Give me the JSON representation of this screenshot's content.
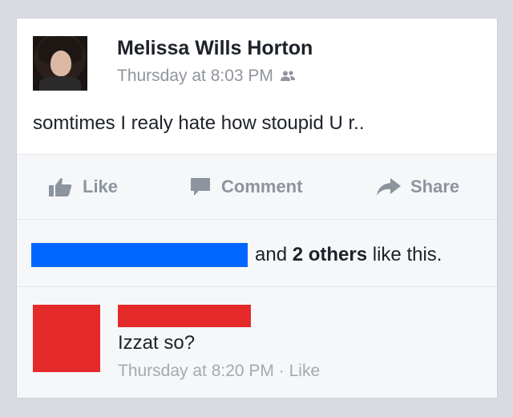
{
  "post": {
    "author": "Melissa Wills Horton",
    "timestamp": "Thursday at 8:03 PM",
    "audience_icon": "friends-icon",
    "text": "somtimes I realy hate how stoupid U r.."
  },
  "actions": {
    "like_label": "Like",
    "comment_label": "Comment",
    "share_label": "Share"
  },
  "likes": {
    "prefix": "and ",
    "others": "2 others",
    "suffix": " like this."
  },
  "comment": {
    "text": "Izzat so?",
    "timestamp": "Thursday at 8:20 PM",
    "separator": " · ",
    "like_label": "Like"
  },
  "colors": {
    "redaction_blue": "#0066ff",
    "redaction_red": "#e52a2a",
    "action_gray": "#8d949e"
  }
}
